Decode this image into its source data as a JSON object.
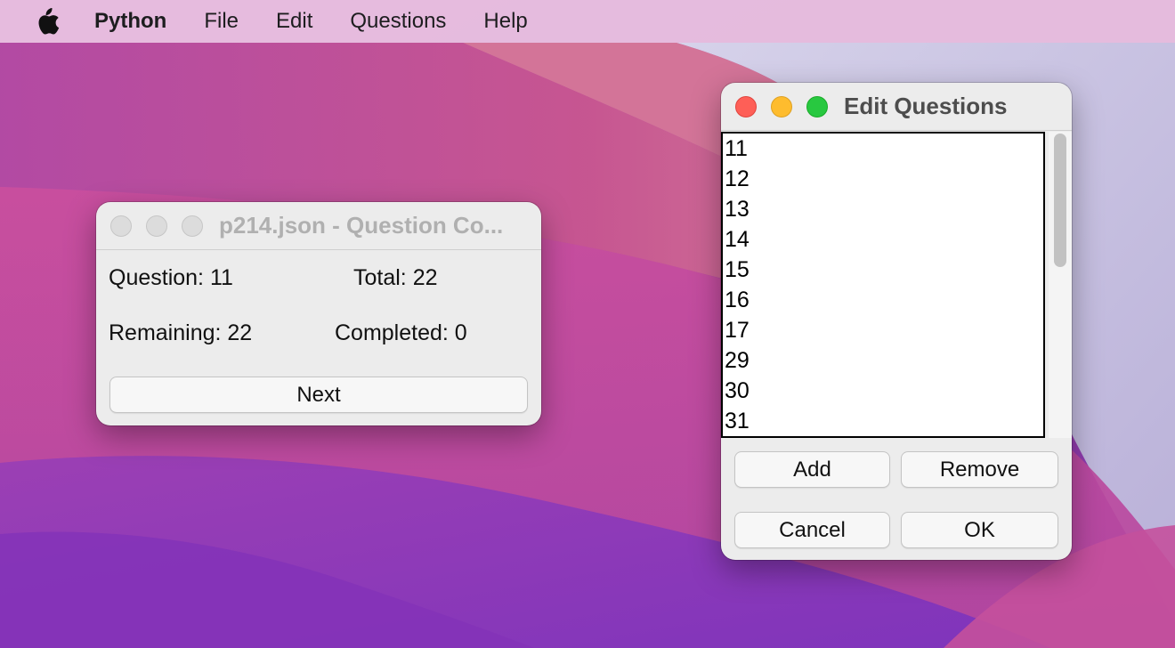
{
  "menubar": {
    "apple_icon": "apple-logo-icon",
    "app_name": "Python",
    "items": [
      "File",
      "Edit",
      "Questions",
      "Help"
    ]
  },
  "counter_window": {
    "title": "p214.json - Question Co...",
    "question_label": "Question: 11",
    "total_label": "Total: 22",
    "remaining_label": "Remaining: 22",
    "completed_label": "Completed: 0",
    "next_button": "Next"
  },
  "editor_window": {
    "title": "Edit Questions",
    "questions": [
      "11",
      "12",
      "13",
      "14",
      "15",
      "16",
      "17",
      "29",
      "30",
      "31"
    ],
    "add_button": "Add",
    "remove_button": "Remove",
    "cancel_button": "Cancel",
    "ok_button": "OK"
  },
  "colors": {
    "close": "#fe5f57",
    "minimize": "#febc2e",
    "zoom": "#28c840",
    "wallpaper_primary": "#b24fa6"
  }
}
